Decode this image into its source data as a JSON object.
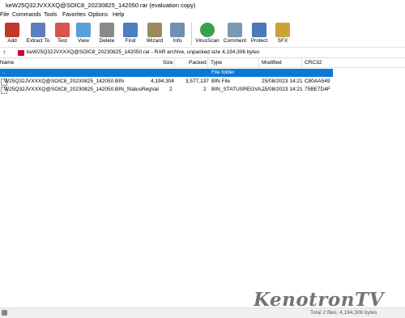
{
  "window": {
    "title": "keW25Q32JVXXXQ@SOIC8_20230825_142050.rar (evaluation copy)"
  },
  "menu": [
    "File",
    "Commands",
    "Tools",
    "Favorites",
    "Options",
    "Help"
  ],
  "toolbar": [
    {
      "label": "Add",
      "icon": "add-icon",
      "color": "#c0392b"
    },
    {
      "label": "Extract To",
      "icon": "extract-icon",
      "color": "#5b7fbf"
    },
    {
      "label": "Test",
      "icon": "test-icon",
      "color": "#d9534f"
    },
    {
      "label": "View",
      "icon": "view-icon",
      "color": "#5aa0d8"
    },
    {
      "label": "Delete",
      "icon": "delete-icon",
      "color": "#8a8a8a"
    },
    {
      "label": "Find",
      "icon": "find-icon",
      "color": "#4a7fc1"
    },
    {
      "label": "Wizard",
      "icon": "wizard-icon",
      "color": "#9b8b5a"
    },
    {
      "label": "Info",
      "icon": "info-icon",
      "color": "#6f8fb5"
    },
    {
      "label": "VirusScan",
      "icon": "virusscan-icon",
      "color": "#3aa24a"
    },
    {
      "label": "Comment",
      "icon": "comment-icon",
      "color": "#7c98b3"
    },
    {
      "label": "Protect",
      "icon": "protect-icon",
      "color": "#4a79b9"
    },
    {
      "label": "SFX",
      "icon": "sfx-icon",
      "color": "#c9a23a"
    }
  ],
  "address": {
    "path": "keW25Q32JVXXXQ@SOIC8_20230825_142050.rar - RAR archive, unpacked size 4,194,306 bytes"
  },
  "columns": {
    "name": "Name",
    "size": "Size",
    "packed": "Packed",
    "type": "Type",
    "modified": "Modified",
    "crc": "CRC32"
  },
  "rows": [
    {
      "name": "..",
      "size": "",
      "packed": "",
      "type": "File folder",
      "modified": "",
      "crc": ""
    },
    {
      "name": "W25Q32JVXXXQ@SOIC8_20230825_142050.BIN",
      "size": "4,194,304",
      "packed": "3,577,137",
      "type": "BIN File",
      "modified": "25/08/2023 14:21",
      "crc": "C80AA549"
    },
    {
      "name": "W25Q32JVXXXQ@SOIC8_20230825_142050.BIN_StatusRegVal",
      "size": "2",
      "packed": "2",
      "type": "BIN_STATUSREGVA...",
      "modified": "25/08/2023 14:21",
      "crc": "75BE7D4F"
    }
  ],
  "status": {
    "total": "Total 2 files, 4,194,306 bytes"
  },
  "watermark": "KenotronTV"
}
